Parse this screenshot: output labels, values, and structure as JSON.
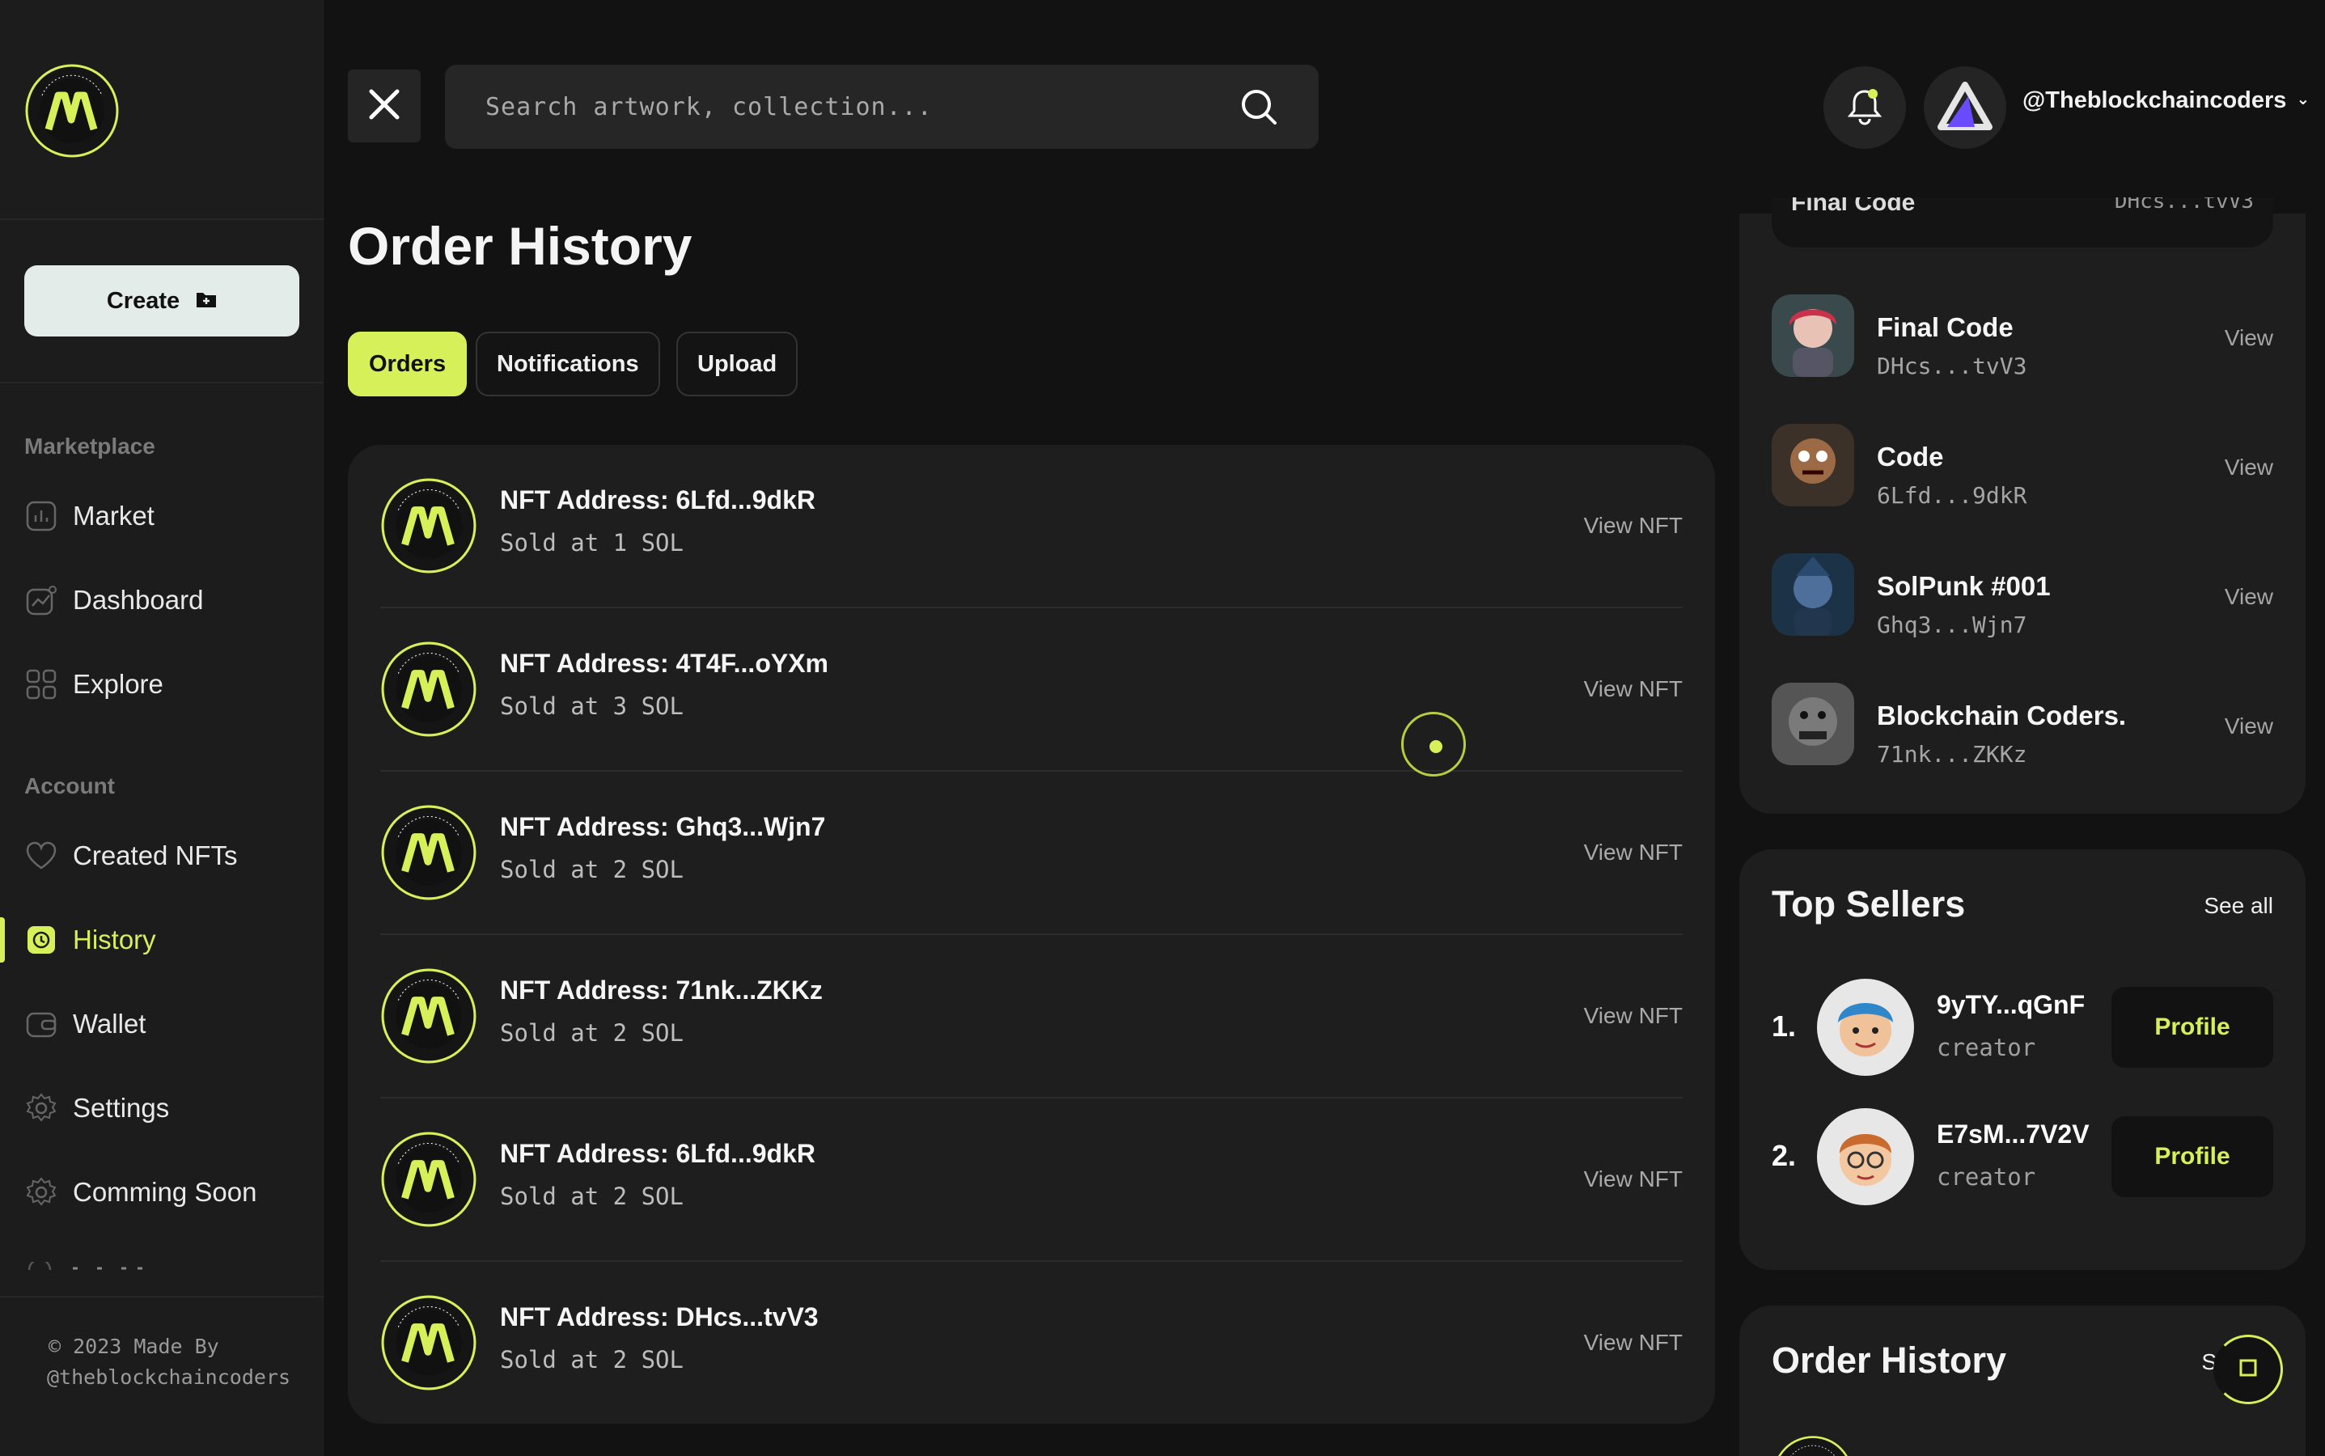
{
  "header": {
    "search_placeholder": "Search artwork, collection...",
    "username": "@Theblockchaincoders"
  },
  "sidebar": {
    "create_label": "Create",
    "marketplace_label": "Marketplace",
    "account_label": "Account",
    "marketplace_items": [
      {
        "label": "Market",
        "icon": "chart-icon"
      },
      {
        "label": "Dashboard",
        "icon": "analytics-icon"
      },
      {
        "label": "Explore",
        "icon": "grid-icon"
      }
    ],
    "account_items": [
      {
        "label": "Created NFTs",
        "icon": "heart-icon"
      },
      {
        "label": "History",
        "icon": "clock-icon"
      },
      {
        "label": "Wallet",
        "icon": "wallet-icon"
      },
      {
        "label": "Settings",
        "icon": "gear-icon"
      },
      {
        "label": "Comming Soon",
        "icon": "gear-icon"
      }
    ],
    "footer_line1": "© 2023 Made By",
    "footer_line2": "@theblockchaincoders"
  },
  "main": {
    "title": "Order History",
    "tabs": [
      "Orders",
      "Notifications",
      "Upload"
    ],
    "active_tab": "Orders",
    "orders": [
      {
        "address": "NFT Address: 6Lfd...9dkR",
        "sold": "Sold at 1 SOL",
        "view": "View NFT"
      },
      {
        "address": "NFT Address: 4T4F...oYXm",
        "sold": "Sold at 3 SOL",
        "view": "View NFT"
      },
      {
        "address": "NFT Address: Ghq3...Wjn7",
        "sold": "Sold at 2 SOL",
        "view": "View NFT"
      },
      {
        "address": "NFT Address: 71nk...ZKKz",
        "sold": "Sold at 2 SOL",
        "view": "View NFT"
      },
      {
        "address": "NFT Address: 6Lfd...9dkR",
        "sold": "Sold at 2 SOL",
        "view": "View NFT"
      },
      {
        "address": "NFT Address: DHcs...tvV3",
        "sold": "Sold at 2 SOL",
        "view": "View NFT"
      }
    ]
  },
  "right": {
    "partial_title": "Final Code",
    "partial_addr": "DHcs...tvV3",
    "collections": [
      {
        "name": "Final Code",
        "addr": "DHcs...tvV3",
        "view": "View"
      },
      {
        "name": "Code",
        "addr": "6Lfd...9dkR",
        "view": "View"
      },
      {
        "name": "SolPunk #001",
        "addr": "Ghq3...Wjn7",
        "view": "View"
      },
      {
        "name": "Blockchain Coders.",
        "addr": "71nk...ZKKz",
        "view": "View"
      }
    ],
    "top_sellers": {
      "title": "Top Sellers",
      "see_all": "See all",
      "sellers": [
        {
          "rank": "1.",
          "name": "9yTY...qGnF",
          "role": "creator",
          "button": "Profile"
        },
        {
          "rank": "2.",
          "name": "E7sM...7V2V",
          "role": "creator",
          "button": "Profile"
        }
      ]
    },
    "order_history": {
      "title": "Order History",
      "see_all": "S"
    }
  },
  "colors": {
    "accent": "#d6f05a",
    "background": "#121212",
    "card": "#1e1e1e"
  }
}
